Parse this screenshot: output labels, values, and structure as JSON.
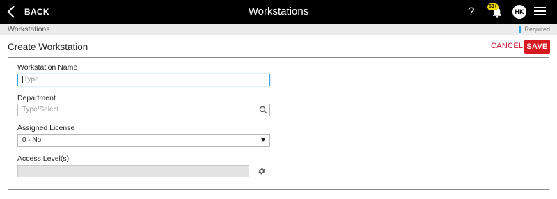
{
  "topbar": {
    "back_label": "BACK",
    "title": "Workstations",
    "help_label": "?",
    "notification_count": "50+",
    "avatar_initials": "HK"
  },
  "breadcrumb": {
    "current": "Workstations",
    "required_label": "Required"
  },
  "header": {
    "title": "Create Workstation",
    "cancel_label": "CANCEL",
    "save_label": "SAVE"
  },
  "form": {
    "workstation_name": {
      "label": "Workstation Name",
      "placeholder": "Type",
      "value": ""
    },
    "department": {
      "label": "Department",
      "placeholder": "Type/Select",
      "value": ""
    },
    "assigned_license": {
      "label": "Assigned License",
      "value": "0 - No"
    },
    "access_levels": {
      "label": "Access Level(s)",
      "value": ""
    }
  },
  "colors": {
    "accent_red": "#d71920",
    "focus_blue": "#3aa6e6",
    "badge_yellow": "#f4d90b"
  }
}
